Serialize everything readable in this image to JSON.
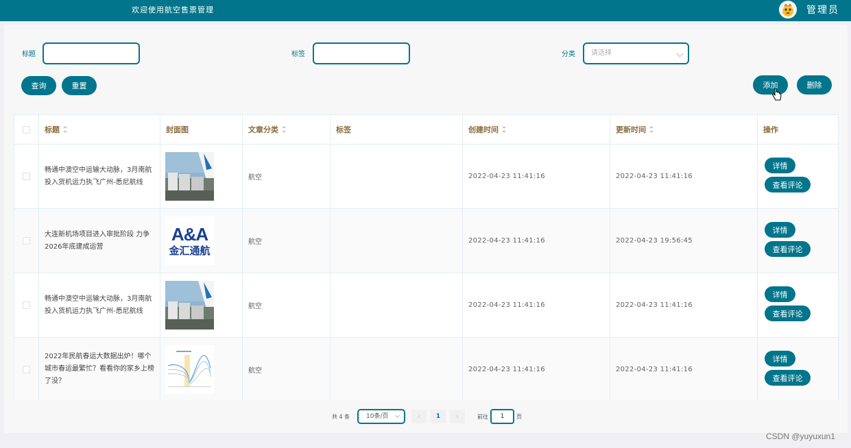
{
  "header": {
    "site_title": "欢迎使用航空售票管理",
    "user_name": "管理员",
    "avatar_icon": "avatar-icon"
  },
  "search": {
    "title_label": "标题",
    "tag_label": "标签",
    "category_label": "分类",
    "category_placeholder": "请选择",
    "query_button": "查询",
    "reset_button": "重置"
  },
  "actions": {
    "add_button": "添加",
    "delete_button": "删除"
  },
  "table": {
    "columns": [
      "标题",
      "封面图",
      "文章分类",
      "标签",
      "创建时间",
      "更新时间",
      "操作"
    ],
    "rows": [
      {
        "title": "畅通中澳空中运输大动脉，3月南航投入货机运力执飞广州-悉尼航线",
        "cover": "cargo-plane-image",
        "category": "航空",
        "tag": "",
        "created": "2022-04-23 11:41:16",
        "updated": "2022-04-23 11:41:16"
      },
      {
        "title": "大连新机场项目进入审批阶段 力争2026年底建成运营",
        "cover": "logo-image",
        "category": "航空",
        "tag": "",
        "created": "2022-04-23 11:41:16",
        "updated": "2022-04-23 19:56:45"
      },
      {
        "title": "畅通中澳空中运输大动脉，3月南航投入货机运力执飞广州-悉尼航线",
        "cover": "cargo-plane-image",
        "category": "航空",
        "tag": "",
        "created": "2022-04-23 11:41:16",
        "updated": "2022-04-23 11:41:16"
      },
      {
        "title": "2022年民航春运大数据出炉！哪个城市春运最繁忙？看看你的家乡上榜了没？",
        "cover": "chart-image",
        "category": "航空",
        "tag": "",
        "created": "2022-04-23 11:41:16",
        "updated": "2022-04-23 11:41:16"
      }
    ],
    "detail_button": "详情",
    "comment_button": "查看评论",
    "logo": {
      "line1": "A&A",
      "line2": "金汇通航"
    }
  },
  "pagination": {
    "total_text": "共 4 条",
    "page_size": "10条/页",
    "current_page": "1",
    "prev_icon": "‹",
    "next_icon": "›",
    "goto_label": "前往",
    "goto_value": "1",
    "page_suffix": "页"
  },
  "watermark": "CSDN @yuyuxun1",
  "colors": {
    "primary": "#00758b",
    "header_text": "#8a6e3e"
  }
}
